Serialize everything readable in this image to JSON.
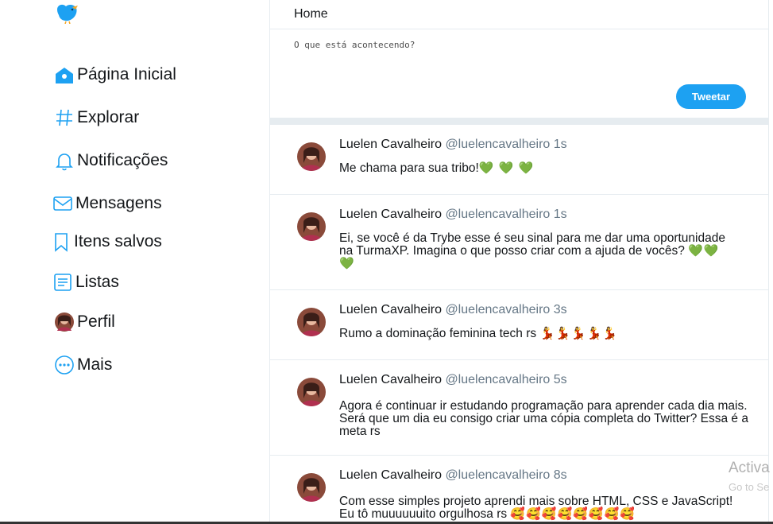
{
  "sidebar": {
    "items": [
      {
        "label": "Página Inicial",
        "icon": "home-icon"
      },
      {
        "label": "Explorar",
        "icon": "hashtag-icon"
      },
      {
        "label": "Notificações",
        "icon": "bell-icon"
      },
      {
        "label": "Mensagens",
        "icon": "mail-icon"
      },
      {
        "label": "Itens salvos",
        "icon": "bookmark-icon"
      },
      {
        "label": "Listas",
        "icon": "list-icon"
      },
      {
        "label": "Perfil",
        "icon": "avatar"
      },
      {
        "label": "Mais",
        "icon": "more-icon"
      }
    ]
  },
  "header": {
    "title": "Home"
  },
  "compose": {
    "placeholder": "O que está acontecendo?",
    "button_label": "Tweetar"
  },
  "tweets": [
    {
      "name": "Luelen Cavalheiro",
      "handle": "@luelencavalheiro",
      "time": "1s",
      "text": "Me chama para sua tribo!",
      "emoji": "💚 💚 💚"
    },
    {
      "name": "Luelen Cavalheiro",
      "handle": "@luelencavalheiro",
      "time": "1s",
      "text": "Ei, se você é da Trybe esse é seu sinal para me dar uma oportunidade na TurmaXP. Imagina o que posso criar com a ajuda de vocês?",
      "emoji": "💚💚 💚"
    },
    {
      "name": "Luelen Cavalheiro",
      "handle": "@luelencavalheiro",
      "time": "3s",
      "text": "Rumo a dominação feminina tech rs",
      "emoji": "💃💃💃💃💃"
    },
    {
      "name": "Luelen Cavalheiro",
      "handle": "@luelencavalheiro",
      "time": "5s",
      "text": "Agora é continuar ir estudando programação para aprender cada dia mais. Será que um dia eu consigo criar uma cópia completa do Twitter? Essa é a meta rs",
      "emoji": ""
    },
    {
      "name": "Luelen Cavalheiro",
      "handle": "@luelencavalheiro",
      "time": "8s",
      "text": "Com esse simples projeto aprendi mais sobre HTML, CSS e JavaScript! Eu tô muuuuuuito orgulhosa rs",
      "emoji": "🥰🥰🥰🥰🥰🥰🥰🥰"
    }
  ],
  "watermark": {
    "line1": "Activa",
    "line2": "Go to Se"
  },
  "colors": {
    "accent": "#1da1f2",
    "heart": "#22c55e",
    "border": "#e6ecf0"
  }
}
